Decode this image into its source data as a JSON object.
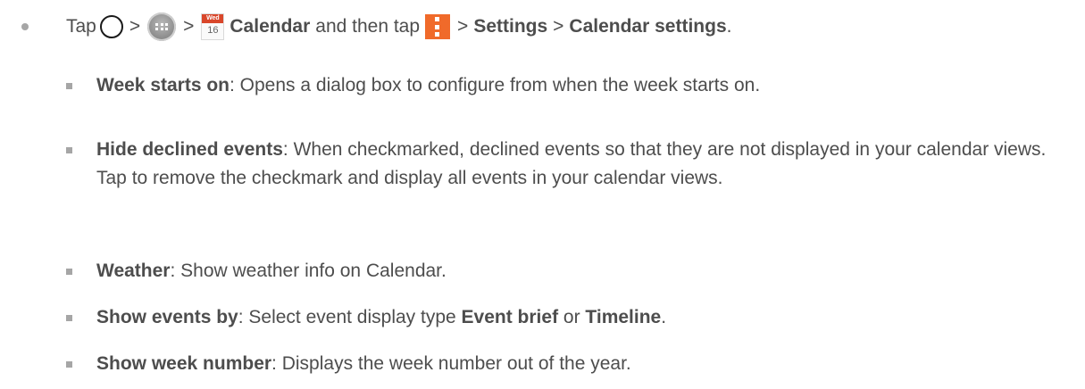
{
  "step": {
    "tap_label": "Tap",
    "gt1": ">",
    "gt2": ">",
    "calendar_icon_day": "Wed",
    "calendar_icon_date": "16",
    "calendar_label": "Calendar",
    "then_tap": "and then tap",
    "gt3": ">",
    "settings": "Settings",
    "gt4": ">",
    "calendar_settings": "Calendar settings",
    "period": "."
  },
  "items": [
    {
      "term": "Week starts on",
      "desc": ": Opens a dialog box to configure from when the week starts on."
    },
    {
      "term": "Hide declined events",
      "desc": ": When checkmarked, declined events so that they are not displayed in your calendar views. Tap to remove the checkmark and display all events in your calendar views."
    },
    {
      "term": "Weather",
      "desc": ": Show weather info on Calendar."
    },
    {
      "term": "Show events by",
      "desc_a": ": Select event display type ",
      "opt1": "Event brief",
      "or": " or ",
      "opt2": "Timeline",
      "end": "."
    },
    {
      "term": "Show week number",
      "desc": ": Displays the week number out of the year."
    }
  ],
  "icons": {
    "home": "home-circle-icon",
    "apps": "apps-icon",
    "calendar": "calendar-app-icon",
    "menu": "overflow-menu-icon"
  },
  "colors": {
    "text": "#4d4d4d",
    "bullet": "#a6a6a6",
    "calendar_header": "#d9472b",
    "menu_icon": "#f06a2a"
  }
}
